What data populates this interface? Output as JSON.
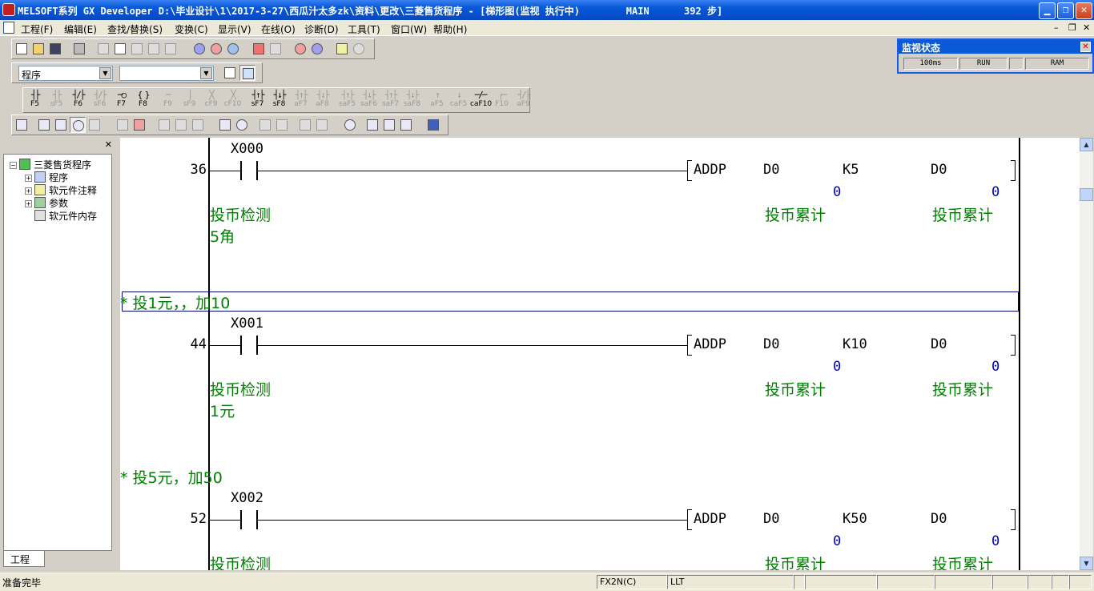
{
  "window": {
    "title": "MELSOFT系列 GX Developer D:\\毕业设计\\1\\2017-3-27\\西瓜汁太多zk\\资料\\更改\\三菱售货程序 - [梯形图(监视 执行中)        MAIN      392 步]",
    "minimize": "▁",
    "restore": "❐",
    "close": "✕"
  },
  "menu": {
    "items": [
      "工程(F)",
      "编辑(E)",
      "查找/替换(S)",
      "变换(C)",
      "显示(V)",
      "在线(O)",
      "诊断(D)",
      "工具(T)",
      "窗口(W)",
      "帮助(H)"
    ],
    "mdi_min": "–",
    "mdi_restore": "❐",
    "mdi_close": "✕"
  },
  "toolbar2": {
    "program_select": "程序",
    "second_select": ""
  },
  "fkeys": [
    {
      "sym": "┤├",
      "label": "F5",
      "dim": false
    },
    {
      "sym": "┤├",
      "label": "sF5",
      "dim": true
    },
    {
      "sym": "┤/├",
      "label": "F6",
      "dim": false
    },
    {
      "sym": "┤/├",
      "label": "sF6",
      "dim": true
    },
    {
      "sym": "─○",
      "label": "F7",
      "dim": false
    },
    {
      "sym": "{ }",
      "label": "F8",
      "dim": false
    },
    {
      "sym": "─",
      "label": "F9",
      "dim": true
    },
    {
      "sym": "│",
      "label": "sF9",
      "dim": true
    },
    {
      "sym": "╳",
      "label": "cF9",
      "dim": true
    },
    {
      "sym": "╳",
      "label": "cF10",
      "dim": true
    },
    {
      "sym": "┤↑├",
      "label": "sF7",
      "dim": false
    },
    {
      "sym": "┤↓├",
      "label": "sF8",
      "dim": false
    },
    {
      "sym": "┤↑├",
      "label": "aF7",
      "dim": true
    },
    {
      "sym": "┤↓├",
      "label": "aF8",
      "dim": true
    },
    {
      "sym": "┤↑├",
      "label": "saF5",
      "dim": true
    },
    {
      "sym": "┤↓├",
      "label": "saF6",
      "dim": true
    },
    {
      "sym": "┤↑├",
      "label": "saF7",
      "dim": true
    },
    {
      "sym": "┤↓├",
      "label": "saF8",
      "dim": true
    },
    {
      "sym": "↑",
      "label": "aF5",
      "dim": true
    },
    {
      "sym": "↓",
      "label": "caF5",
      "dim": true
    },
    {
      "sym": "─/─",
      "label": "caF10",
      "dim": false
    },
    {
      "sym": "┌─",
      "label": "F10",
      "dim": true
    },
    {
      "sym": "┤/├",
      "label": "aF9",
      "dim": true
    }
  ],
  "monitor_panel": {
    "title": "监视状态",
    "close": "✕",
    "scan_time": "100ms",
    "run_state": "RUN",
    "memory": "RAM"
  },
  "project_tree": {
    "close": "✕",
    "root": "三菱售货程序",
    "items": [
      "程序",
      "软元件注释",
      "参数",
      "软元件内存"
    ],
    "tab": "工程"
  },
  "ladder": {
    "rungs": [
      {
        "step": "36",
        "contact": "X000",
        "instr": "ADDP",
        "op1": "D0",
        "op1_val": "0",
        "op2": "K5",
        "op3": "D0",
        "op3_val": "0",
        "contact_comment": "投币检测",
        "contact_comment2": "5角",
        "op1_comment": "投币累计",
        "op3_comment": "投币累计"
      },
      {
        "statement": "* 投1元，，加10",
        "step": "44",
        "contact": "X001",
        "instr": "ADDP",
        "op1": "D0",
        "op1_val": "0",
        "op2": "K10",
        "op3": "D0",
        "op3_val": "0",
        "contact_comment": "投币检测",
        "contact_comment2": "1元",
        "op1_comment": "投币累计",
        "op3_comment": "投币累计"
      },
      {
        "statement": "* 投5元，加50",
        "step": "52",
        "contact": "X002",
        "instr": "ADDP",
        "op1": "D0",
        "op1_val": "0",
        "op2": "K50",
        "op3": "D0",
        "op3_val": "0",
        "contact_comment": "投币检测",
        "op1_comment": "投币累计",
        "op3_comment": "投币累计"
      }
    ]
  },
  "scrollbar": {
    "up": "▲",
    "down": "▼"
  },
  "statusbar": {
    "message": "准备完毕",
    "plc_type": "FX2N(C)",
    "mode": "LLT"
  }
}
